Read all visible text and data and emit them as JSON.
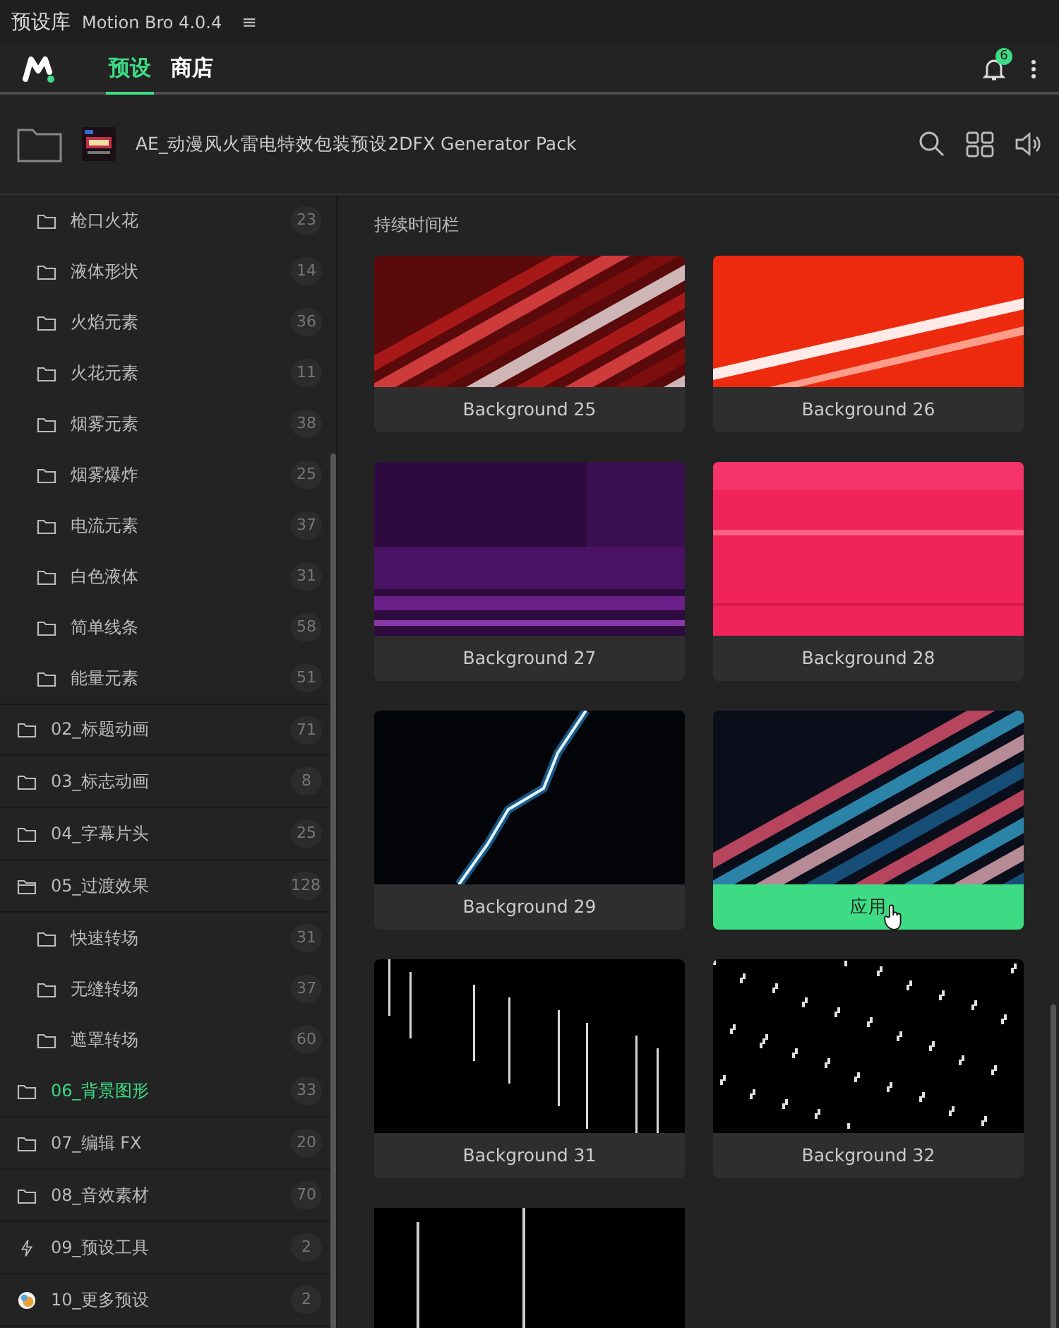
{
  "titlebar": {
    "title": "预设库",
    "app": "Motion Bro 4.0.4",
    "menu_glyph": "≡"
  },
  "nav": {
    "tabs": [
      {
        "label": "预设",
        "selected": true
      },
      {
        "label": "商店",
        "selected": false
      }
    ],
    "notifications": "6"
  },
  "pack": {
    "title": "AE_动漫风火雷电特效包装预设2DFX Generator Pack"
  },
  "sidebar": {
    "items": [
      {
        "children": [
          {
            "label": "枪口火花",
            "count": "23",
            "kind": "folder",
            "selected": false
          },
          {
            "label": "液体形状",
            "count": "14",
            "kind": "folder",
            "selected": false
          },
          {
            "label": "火焰元素",
            "count": "36",
            "kind": "folder",
            "selected": false
          },
          {
            "label": "火花元素",
            "count": "11",
            "kind": "folder",
            "selected": false
          },
          {
            "label": "烟雾元素",
            "count": "38",
            "kind": "folder",
            "selected": false
          },
          {
            "label": "烟雾爆炸",
            "count": "25",
            "kind": "folder",
            "selected": false
          },
          {
            "label": "电流元素",
            "count": "37",
            "kind": "folder",
            "selected": false
          },
          {
            "label": "白色液体",
            "count": "31",
            "kind": "folder",
            "selected": false
          },
          {
            "label": "简单线条",
            "count": "58",
            "kind": "folder",
            "selected": false
          },
          {
            "label": "能量元素",
            "count": "51",
            "kind": "folder",
            "selected": false
          }
        ]
      },
      {
        "label": "02_标题动画",
        "count": "71",
        "kind": "folder",
        "selected": false
      },
      {
        "label": "03_标志动画",
        "count": "8",
        "kind": "folder",
        "selected": false
      },
      {
        "label": "04_字幕片头",
        "count": "25",
        "kind": "folder",
        "selected": false
      },
      {
        "label": "05_过渡效果",
        "count": "128",
        "kind": "open-folder",
        "selected": false,
        "children": [
          {
            "label": "快速转场",
            "count": "31",
            "kind": "folder",
            "selected": false
          },
          {
            "label": "无缝转场",
            "count": "37",
            "kind": "folder",
            "selected": false
          },
          {
            "label": "遮罩转场",
            "count": "60",
            "kind": "folder",
            "selected": false
          }
        ]
      },
      {
        "label": "06_背景图形",
        "count": "33",
        "kind": "folder",
        "selected": true
      },
      {
        "label": "07_编辑 FX",
        "count": "20",
        "kind": "folder",
        "selected": false
      },
      {
        "label": "08_音效素材",
        "count": "70",
        "kind": "folder",
        "selected": false
      },
      {
        "label": "09_预设工具",
        "count": "2",
        "kind": "bolt",
        "selected": false
      },
      {
        "label": "10_更多预设",
        "count": "2",
        "kind": "avatar",
        "selected": false
      }
    ]
  },
  "content": {
    "section": "持续时间栏",
    "cards": [
      {
        "label": "Background 25"
      },
      {
        "label": "Background 26"
      },
      {
        "label": "Background 27"
      },
      {
        "label": "Background 28"
      },
      {
        "label": "Background 29"
      },
      {
        "action": "应用"
      },
      {
        "label": "Background 31"
      },
      {
        "label": "Background 32"
      },
      {
        "kind": "picture"
      }
    ]
  }
}
